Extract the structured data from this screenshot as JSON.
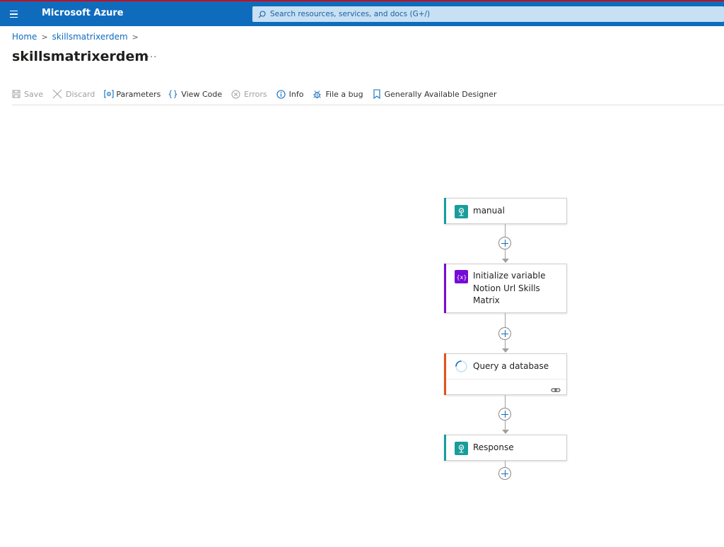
{
  "header": {
    "brand": "Microsoft Azure",
    "search_placeholder": "Search resources, services, and docs (G+/)",
    "accent_color": "#0f6cbd"
  },
  "breadcrumb": {
    "home": "Home",
    "resource": "skillsmatrixerdem"
  },
  "page": {
    "title": "skillsmatrixerdem",
    "more": "···"
  },
  "toolbar": {
    "save": "Save",
    "discard": "Discard",
    "parameters": "Parameters",
    "view_code": "View Code",
    "errors": "Errors",
    "info": "Info",
    "file_bug": "File a bug",
    "designer": "Generally Available Designer"
  },
  "flow": {
    "steps": [
      {
        "label": "manual",
        "icon": "request-icon",
        "color": "#1a9c9c"
      },
      {
        "label": "Initialize variable Notion Url Skills Matrix",
        "icon": "variable-icon",
        "color": "#770bd6"
      },
      {
        "label": "Query a database",
        "icon": "loading-spinner-icon",
        "color": "#e0531b"
      },
      {
        "label": "Response",
        "icon": "request-icon",
        "color": "#1a9c9c"
      }
    ]
  }
}
